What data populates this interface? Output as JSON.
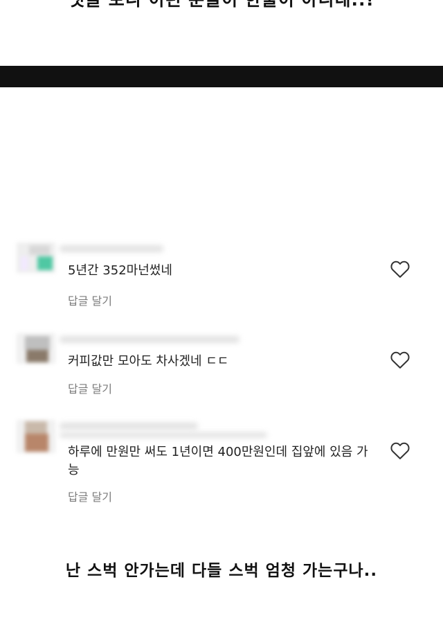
{
  "captions": {
    "top": "댓글 보니 이런 분들이 한둘이 아니네..!",
    "bottom": "난 스벅 안가는데 다들 스벅 엄청 가는구나.."
  },
  "comments": [
    {
      "text": "5년간 352마넌썼네",
      "reply": "답글 달기",
      "avatar_color": "#4fc8a3"
    },
    {
      "text": "커피값만 모아도 차사겠네 ㄷㄷ",
      "reply": "답글 달기",
      "avatar_color": "#8a7a6a"
    },
    {
      "text": "하루에 만원만 써도 1년이면 400만원인데 집앞에 있음 가능",
      "reply": "답글 달기",
      "avatar_color": "#b8866a"
    }
  ],
  "icons": {
    "like": "heart-outline-icon"
  },
  "colors": {
    "band": "#111111",
    "reply_text": "#7b7b7b",
    "comment_text": "#222222"
  }
}
